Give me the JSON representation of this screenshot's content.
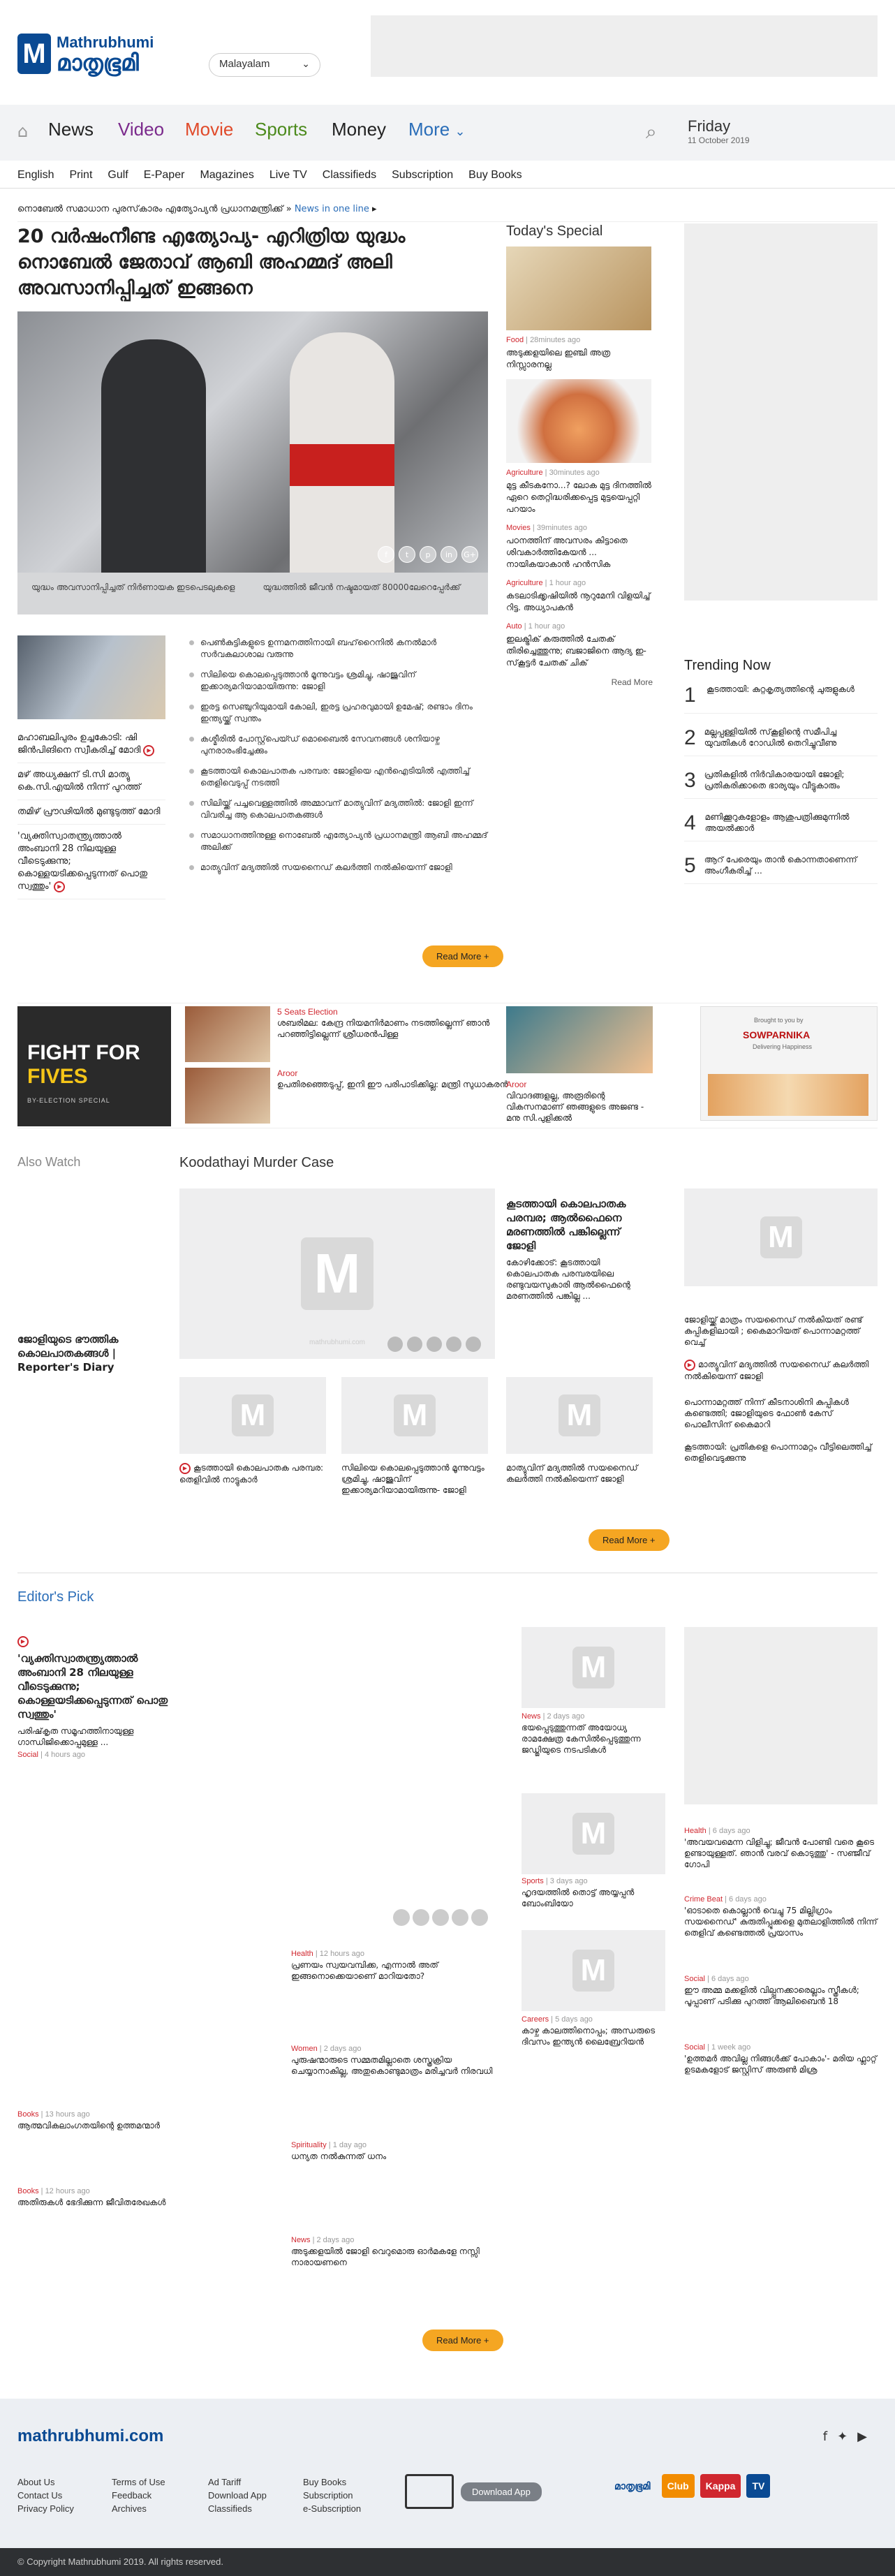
{
  "header": {
    "brand_en": "Mathrubhumi",
    "brand_ml": "മാതൃഭൂമി",
    "lang": "Malayalam"
  },
  "nav": {
    "items": [
      "News",
      "Video",
      "Movie",
      "Sports",
      "Money",
      "More"
    ],
    "colors": [
      "#333333",
      "#7b2a8c",
      "#e04a2a",
      "#4c8a1c",
      "#333333",
      "#2a6db8"
    ],
    "date_day": "Friday",
    "date": "11 October 2019"
  },
  "subnav": [
    "English",
    "Print",
    "Gulf",
    "E-Paper",
    "Magazines",
    "Live TV",
    "Classifieds",
    "Subscription",
    "Buy Books"
  ],
  "ticker": {
    "text": "നൊബേല്‍ സമാധാന പുരസ്‌കാരം എത്യോപ്യന്‍ പ്രധാനമന്ത്രിക്ക്",
    "link": "News in one line"
  },
  "lead": {
    "headline": "20 വര്‍ഷംനീണ്ട എത്യോപ്യ- എറിത്രിയ യുദ്ധം നൊബേല്‍ ജേതാവ് ആബി അഹമ്മദ് അലി അവസാനിപ്പിച്ചത് ഇങ്ങനെ",
    "cap1": "യുദ്ധം അവസാനിപ്പിച്ചത് നിർണായക ഇടപെടലുകളെ",
    "cap2": "യുദ്ധത്തിൽ ജീവൻ നഷ്ടമായത് 80000ലേറെപ്പേർക്ക്"
  },
  "share_icons": [
    "f",
    "t",
    "p",
    "in",
    "G+"
  ],
  "sidelist": [
    {
      "text": "മഹാബലിപുരം ഉച്ചകോടി: ഷി ജിന്‍പിങിനെ സ്വീകരിച്ച് മോദി"
    },
    {
      "text": "മഴ് അധ്യക്ഷന് ടി.സി മാത്യു കെ.സി.എയില്‍ നിന്ന് പുറത്ത്"
    },
    {
      "text": "തമിഴ് പ്രൗഢിയില്‍ മുണ്ടുടുത്ത് മോദി"
    },
    {
      "text": "'വ്യക്തിസ്വാതന്ത്ര്യത്താല്‍ അംബാനി 28 നിലയുള്ള വീടെടുക്കുന്നു; കൊള്ളയടിക്കപ്പെടുന്നത് പൊതു സ്വത്തും'"
    }
  ],
  "bullets": [
    "പെണ്‍കുട്ടികളുടെ ഉന്നമനത്തിനായി ബഹ്‌റൈനില്‍ കനൽമാര്‍ സര്‍വകലാശാല വരുന്നു",
    "സിലിയെ കൊലപ്പെടുത്താന്‍ മൂന്നുവട്ടം ശ്രമിച്ചു, ഷാജുവിന് ഇക്കാര്യമറിയാമായിരുന്നു: ജോളി",
    "ഇരട്ട സെഞ്ചുറിയുമായി കോലി, ഇരട്ട പ്രഹരവുമായി ഉമേഷ്; രണ്ടാം ദിനം ഇന്ത്യയ്ക്ക് സ്വന്തം",
    "കശ്മീരില്‍ പോസ്റ്റ്‌പെയ്ഡ് മൊബൈല്‍ സേവനങ്ങള്‍ ശനിയാഴ്ച പുനരാരംഭിച്ചേക്കും",
    "കൂടത്തായി കൊലപാതക പരമ്പര: ജോളിയെ എന്‍ഐടിയില്‍ എത്തിച്ച് തെളിവെടുപ്പ് നടത്തി",
    "സിലിയ്ക്ക് പച്ചവെള്ളത്തില്‍ അമ്മാവന് മാത്യുവിന് മദ്യത്തില്‍: ജോളി ഇന്ന് വിവരിച്ച ആ കൊലപാതകങ്ങള്‍",
    "സമാധാനത്തിനുള്ള നൊബേല്‍ എത്യോപ്യന്‍ പ്രധാനമന്ത്രി ആബി അഹമ്മദ് അലിക്ക്",
    "മാത്യുവിന് മദ്യത്തില്‍ സയനൈഡ് കലര്‍ത്തി നല്‍കിയെന്ന് ജോളി"
  ],
  "readmore": "Read More +",
  "today": {
    "title": "Today's Special",
    "cards": [
      {
        "tag": "Food",
        "time": "28minutes ago",
        "title": "അടുക്കളയിലെ ഇഞ്ചി അത്ര നിസ്സാരനല്ല"
      },
      {
        "tag": "Agriculture",
        "time": "30minutes ago",
        "title": "മുട്ട കീടകനോ...? ലോക മുട്ട ദിനത്തില്‍ ഏറെ തെറ്റിദ്ധരിക്കപ്പെട്ട മുട്ടയെപ്പറ്റി പറയാം"
      },
      {
        "tag": "Movies",
        "time": "39minutes ago",
        "title": "പഠനത്തിന് അവസരം കിട്ടാതെ ശിവകാര്‍ത്തികേയന്‍ ... നായികയാകാന്‍ ഹന്‍സിക"
      },
      {
        "tag": "Agriculture",
        "time": "1 hour ago",
        "title": "കടലാടിക്കൃഷിയില്‍ നൂറുമേനി വിളയിച്ച് റിട്ട. അധ്യാപകന്‍"
      },
      {
        "tag": "Auto",
        "time": "1 hour ago",
        "title": "ഇലക്ട്രിക് കരുത്തില്‍ ചേതക് തിരിച്ചെത്തുന്നു; ബജാജിനെ ആദ്യ ഇ-സ്‌കൂട്ടര്‍ ചേതക് ചിക്"
      }
    ],
    "more": "Read More"
  },
  "trending": {
    "title": "Trending Now",
    "items": [
      {
        "n": "1",
        "t": "കൂടത്തായി: കുറ്റകൃത്യത്തിന്റെ ചുരുളുകള്‍"
      },
      {
        "n": "2",
        "t": "മല്ലപ്പള്ളിയില്‍ സ്‌കൂളിന്റെ സമീപിച്ച യുവതികള്‍ റോഡില്‍ തെറിച്ചുവീണു"
      },
      {
        "n": "3",
        "t": "പ്രതികളില്‍ നിര്‍വികാരയായി ജോളി; പ്രതികരിക്കാതെ ഭാര്യയും വീട്ടുകാരും"
      },
      {
        "n": "4",
        "t": "മണിക്കൂറുകളോളം ആശുപത്രിക്കുമുന്നില്‍ അയല്‍ക്കാര്‍"
      },
      {
        "n": "5",
        "t": "ആറ് പേരെയും താന്‍ കൊന്നതാണെന്ന് അംഗീകരിച്ച് ..."
      }
    ]
  },
  "election": {
    "banner1": "FIGHT FOR",
    "banner2": "FIVES",
    "banner_sub": "BY-ELECTION SPECIAL",
    "c1_tag": "5 Seats Election",
    "c1": "ശബരിമല: കേന്ദ്ര നിയമനിര്‍മാണം നടത്തില്ലെന്ന് ഞാന്‍ പറഞ്ഞിട്ടില്ലെന്ന് ശ്രീധരന്‍പിള്ള",
    "c2_tag": "Aroor",
    "c2": "ഉപതിരഞ്ഞെടുപ്പ്, ഇനി ഈ പരിപാടിക്കില്ല: മന്ത്രി സുധാകരന്‍",
    "c3_tag": "Aroor",
    "c3": "വിവാദങ്ങളല്ല, അരൂരിന്റെ വികസനമാണ് ഞങ്ങളുടെ അജണ്ട - മനു സി.പുളിക്കല്‍",
    "sponsor_pre": "Brought to you by",
    "sponsor": "SOWPARNIKA",
    "sponsor_sub": "Delivering Happiness"
  },
  "alsowatch": {
    "title": "Also Watch",
    "main": "ജോളിയുടെ ഭൗത്തിക കൊലപാതകങ്ങള്‍ | Reporter's Diary"
  },
  "koodathayi": {
    "title": "Koodathayi Murder Case",
    "lead_head": "കൂടത്തായി കൊലപാതക പരമ്പര; ആല്‍ഫൈനെ മരണത്തില്‍ പങ്കില്ലെന്ന് ജോളി",
    "lead_sub": "കോഴിക്കോട്: കൂടത്തായി കൊലപാതക പരമ്പരയിലെ രണ്ടുവയസുകാരി ആല്‍ഫൈന്റെ മരണത്തില്‍ പങ്കില്ല ...",
    "r1": "ജോളിയ്ക്ക് മാത്രം സയനൈഡ് നല്‍കിയത് രണ്ട് കുപ്പികളിലായി ; കൈമാറിയത് പൊന്നാമറ്റത്ത് വെച്ച്",
    "r2": "മാത്യുവിന് മദ്യത്തില്‍ സയനൈഡ് കലര്‍ത്തി നല്‍കിയെന്ന് ജോളി",
    "r3": "പൊന്നാമറ്റത്ത് നിന്ന് കീടനാശിനി കുപ്പികള്‍ കണ്ടെത്തി; ജോളിയുടെ ഫോണ്‍ കേസ് പൊലീസിന് കൈമാറി",
    "r4": "കൂടത്തായി: പ്രതികളെ പൊന്നാമറ്റം വീട്ടിലെത്തിച്ച് തെളിവെടുക്കുന്നു",
    "b1": "കൂടത്തായി കൊലപാതക പരമ്പര: തെളിവില്‍ നാട്ടുകാര്‍",
    "b2": "സിലിയെ കൊലപ്പെടുത്താന്‍ മൂന്നുവട്ടം ശ്രമിച്ചു, ഷാജുവിന് ഇക്കാര്യമറിയാമായിരുന്നു- ജോളി",
    "b3": "മാത്യുവിന് മദ്യത്തില്‍ സയനൈഡ് കലര്‍ത്തി നല്‍കിയെന്ന് ജോളി",
    "wm": "mathrubhumi.com"
  },
  "editors": {
    "title": "Editor's Pick",
    "lead_head": "'വ്യക്തിസ്വാതന്ത്ര്യത്താല്‍ അംബാനി 28 നിലയുള്ള വീടെടുക്കുന്നു; കൊള്ളയടിക്കപ്പെടുന്നത് പൊതു സ്വത്തും'",
    "lead_sub": "പരിഷ്‌കൃത സമൂഹത്തിനായുള്ള ഗാന്ധിജിക്കൊപ്പമുള്ള ...",
    "lead_tag": "Social",
    "lead_time": "4 hours ago",
    "items": [
      {
        "tag": "News",
        "time": "2 days ago",
        "t": "ഭയപ്പെടുത്തുന്നത് അയോധ്യ രാമക്ഷേത്ര കേസില്‍പ്പെടുത്തുന്ന ജഡ്ജിയുടെ നടപടികള്‍"
      },
      {
        "tag": "Sports",
        "time": "3 days ago",
        "t": "ഹൃദയത്തില്‍ തൊട്ട് അയ്യപ്പൻ ബോംബിയോ"
      },
      {
        "tag": "Careers",
        "time": "5 days ago",
        "t": "കാഴ്ച കാലത്തിനൊപ്പം; അന്ധരുടെ ദിവസം ഇന്ത്യന്‍ ലൈബ്രേറിയന്‍"
      },
      {
        "tag": "Health",
        "time": "6 days ago",
        "t": "'അവയവമെന്ന വിളിച്ചു; ജീവന്‍ പോണ്ടി വരെ കൂടെ ഉണ്ടായുള്ളത്. ഞാന്‍ വരവ് കൊടുത്തു' - സഞ്ജീവ് ഗോപി"
      },
      {
        "tag": "Crime Beat",
        "time": "6 days ago",
        "t": "'ഓടാതെ കൊല്ലാന്‍ വെച്ചു 75 മില്ലിഗ്രാം സയനൈഡ്' കുരുതിപ്പൂക്കളെ മുതലാളിത്തില്‍ നിന്ന് തെളിവ് കണ്ടെത്തല്‍ പ്രയാസം"
      },
      {
        "tag": "Social",
        "time": "6 days ago",
        "t": "ഈ അമ്മ മക്കളില്‍ വില്പ്പനക്കാരെല്ലാം സ്ത്രീകള്‍; പൂപ്പാണ് പടിക്കു പുറത്ത് ആലിബൈന്‍ 18"
      },
      {
        "tag": "Social",
        "time": "1 week ago",
        "t": "'ഉത്തമര്‍ അവില്ല നിങ്ങള്‍ക്ക് പോകാം'- മരിയ ഫ്ലാറ്റ് ഉടമകളോട് ജസ്റ്റിസ് അരുണ്‍ മിശ്ര"
      },
      {
        "tag": "Health",
        "time": "12 hours ago",
        "t": "പ്രണയം സ്വയവമ്പിക്ക, എന്നാല്‍ അത് ഇങ്ങനൊക്കെയാണെ് മാറിയതോ?"
      },
      {
        "tag": "Women",
        "time": "2 days ago",
        "t": "പുരുഷന്മാരുടെ സമ്മതമില്ലാതെ ശസ്ത്രക്രിയ ചെയ്യാനാകില്ല, അതുകൊണ്ടുമാത്രം മരിച്ചവര്‍ നിരവധി"
      },
      {
        "tag": "Spirituality",
        "time": "1 day ago",
        "t": "ധന്യത നല്‍കുന്നത് ധനം"
      },
      {
        "tag": "News",
        "time": "2 days ago",
        "t": "അടുക്കളയില്‍ ജോളി വെറുമൊരു ഓര്‍മകളേ നസ്സി നാരായണനെ"
      },
      {
        "tag": "Books",
        "time": "13 hours ago",
        "t": "ആത്മവികലാംഗതയിന്റെ ഉത്തമന്മാര്‍"
      },
      {
        "tag": "Books",
        "time": "12 hours ago",
        "t": "അതിരുകള്‍ ഭേദിക്കുന്ന ജീവിതരേഖകള്‍"
      }
    ]
  },
  "footer": {
    "site": "mathrubhumi.com",
    "c1": [
      "About Us",
      "Contact Us",
      "Privacy Policy"
    ],
    "c2": [
      "Terms of Use",
      "Feedback",
      "Archives"
    ],
    "c3": [
      "Ad Tariff",
      "Download App",
      "Classifieds"
    ],
    "c4": [
      "Buy Books",
      "Subscription",
      "e-Subscription"
    ],
    "download": "Download App",
    "brands": [
      "മാതൃഭൂമി",
      "Club",
      "Kappa",
      "TV"
    ],
    "copyright": "© Copyright Mathrubhumi 2019. All rights reserved."
  }
}
